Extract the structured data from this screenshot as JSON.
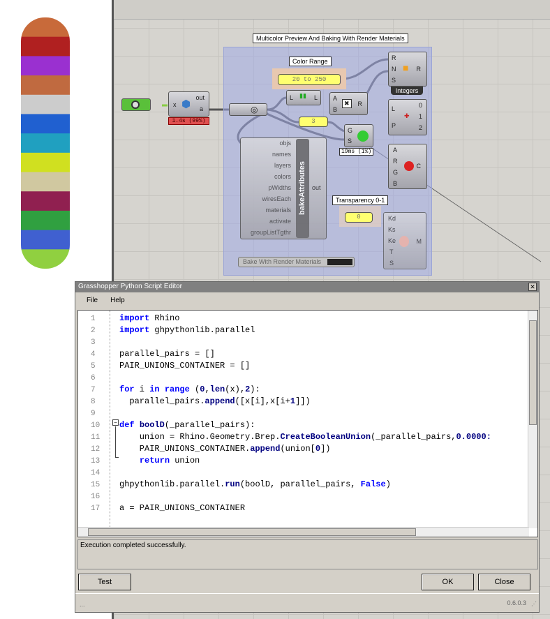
{
  "canvas": {
    "group_title": "Multicolor Preview And Baking With Render Materials",
    "color_range_label": "Color Range",
    "color_range_value": "20 to 250",
    "integers_label": "Integers",
    "python_node": {
      "input": "x",
      "outputs": [
        "out",
        "a"
      ],
      "timing": "1.4s (99%)"
    },
    "number_slider_value": "3",
    "preview_timing": "19ms (1%)",
    "random_node": {
      "inputs": [
        "R",
        "N",
        "S"
      ],
      "output": "R"
    },
    "list_node": {
      "input": "L",
      "output": "L"
    },
    "multiply_node": {
      "inputs": [
        "A",
        "B"
      ],
      "output": "R"
    },
    "preview_node": {
      "inputs": [
        "G",
        "S"
      ]
    },
    "explode_node": {
      "inputs": [
        "L",
        "P"
      ],
      "outputs": [
        "0",
        "1",
        "2"
      ]
    },
    "color_node": {
      "inputs": [
        "A",
        "R",
        "G",
        "B"
      ],
      "output": "C"
    },
    "bake_node": {
      "title": "bakeAttributes",
      "inputs": [
        "objs",
        "names",
        "layers",
        "colors",
        "pWidths",
        "wiresEach",
        "materials",
        "activate",
        "groupListTgthr"
      ],
      "output": "out"
    },
    "transparency_label": "Transparency 0-1",
    "transparency_value": "0",
    "material_node": {
      "inputs": [
        "Kd",
        "Ks",
        "Ke",
        "T",
        "S"
      ],
      "output": "M"
    },
    "bake_button": "Bake With Render Materials"
  },
  "editor": {
    "title": "Grasshopper Python Script Editor",
    "menu": [
      "File",
      "Help"
    ],
    "colors": {
      "keyword": "#0000ff",
      "builtin": "#000080",
      "number": "#000080",
      "text": "#000000"
    },
    "lines": [
      [
        {
          "t": "import",
          "c": "keyword"
        },
        {
          "t": " Rhino",
          "c": "text"
        }
      ],
      [
        {
          "t": "import",
          "c": "keyword"
        },
        {
          "t": " ghpythonlib.parallel",
          "c": "text"
        }
      ],
      [],
      [
        {
          "t": "parallel_pairs = []",
          "c": "text"
        }
      ],
      [
        {
          "t": "PAIR_UNIONS_CONTAINER = []",
          "c": "text"
        }
      ],
      [],
      [
        {
          "t": "for",
          "c": "keyword"
        },
        {
          "t": " i ",
          "c": "text"
        },
        {
          "t": "in",
          "c": "keyword"
        },
        {
          "t": " ",
          "c": "text"
        },
        {
          "t": "range",
          "c": "keyword"
        },
        {
          "t": " (",
          "c": "text"
        },
        {
          "t": "0",
          "c": "number"
        },
        {
          "t": ",",
          "c": "text"
        },
        {
          "t": "len",
          "c": "builtin"
        },
        {
          "t": "(x),",
          "c": "text"
        },
        {
          "t": "2",
          "c": "number"
        },
        {
          "t": "):",
          "c": "text"
        }
      ],
      [
        {
          "t": "  parallel_pairs.",
          "c": "text"
        },
        {
          "t": "append",
          "c": "builtin"
        },
        {
          "t": "([x[i],x[i+",
          "c": "text"
        },
        {
          "t": "1",
          "c": "number"
        },
        {
          "t": "]])",
          "c": "text"
        }
      ],
      [],
      [
        {
          "t": "def",
          "c": "keyword"
        },
        {
          "t": " ",
          "c": "text"
        },
        {
          "t": "boolD",
          "c": "builtin"
        },
        {
          "t": "(_parallel_pairs):",
          "c": "text"
        }
      ],
      [
        {
          "t": "    union = Rhino.Geometry.Brep.",
          "c": "text"
        },
        {
          "t": "CreateBooleanUnion",
          "c": "builtin"
        },
        {
          "t": "(_parallel_pairs,",
          "c": "text"
        },
        {
          "t": "0.0000:",
          "c": "number"
        }
      ],
      [
        {
          "t": "    PAIR_UNIONS_CONTAINER.",
          "c": "text"
        },
        {
          "t": "append",
          "c": "builtin"
        },
        {
          "t": "(union[",
          "c": "text"
        },
        {
          "t": "0",
          "c": "number"
        },
        {
          "t": "])",
          "c": "text"
        }
      ],
      [
        {
          "t": "    ",
          "c": "text"
        },
        {
          "t": "return",
          "c": "keyword"
        },
        {
          "t": " union",
          "c": "text"
        }
      ],
      [],
      [
        {
          "t": "ghpythonlib.parallel.",
          "c": "text"
        },
        {
          "t": "run",
          "c": "builtin"
        },
        {
          "t": "(boolD, parallel_pairs, ",
          "c": "text"
        },
        {
          "t": "False",
          "c": "keyword"
        },
        {
          "t": ")",
          "c": "text"
        }
      ],
      [],
      [
        {
          "t": "a = PAIR_UNIONS_CONTAINER",
          "c": "text"
        }
      ]
    ],
    "status": "Execution completed successfully.",
    "buttons": {
      "test": "Test",
      "ok": "OK",
      "close": "Close"
    },
    "footer_left": "...",
    "version": "0.6.0.3"
  },
  "viewport_band_colors": [
    "#c86a3a",
    "#b02020",
    "#9a30d0",
    "#c06a40",
    "#cccccc",
    "#2060d0",
    "#20a0c0",
    "#d0e020",
    "#d0c8a0",
    "#902050",
    "#30a040",
    "#4060d0",
    "#90d040"
  ]
}
